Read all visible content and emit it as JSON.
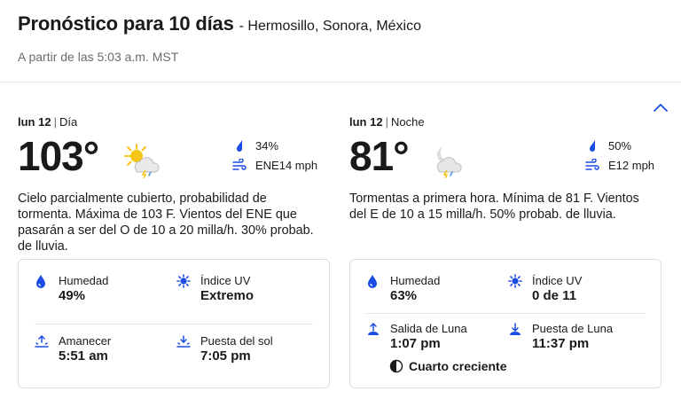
{
  "header": {
    "title": "Pronóstico para 10 días",
    "subtitle": "- Hermosillo, Sonora, México",
    "as_of": "A partir de las 5:03 a.m. MST"
  },
  "colors": {
    "accent": "#1b4de4",
    "text": "#1a1a1a",
    "muted": "#6b6b6b",
    "sun": "#f5c518"
  },
  "day": {
    "date": "lun 12",
    "period": "Día",
    "temp": "103°",
    "icon": "partly-cloudy-thunder-icon",
    "precip": "34%",
    "wind": "ENE14 mph",
    "narrative": "Cielo parcialmente cubierto, probabilidad de tormenta. Máxima de 103 F. Vientos del ENE que pasarán a ser del O de 10 a 20 milla/h. 30% probab. de lluvia.",
    "details": {
      "humidity_label": "Humedad",
      "humidity": "49%",
      "uv_label": "Índice UV",
      "uv": "Extremo",
      "sunrise_label": "Amanecer",
      "sunrise": "5:51 am",
      "sunset_label": "Puesta del sol",
      "sunset": "7:05 pm"
    }
  },
  "night": {
    "date": "lun 12",
    "period": "Noche",
    "temp": "81°",
    "icon": "night-cloud-thunder-icon",
    "precip": "50%",
    "wind": "E12 mph",
    "narrative": "Tormentas a primera hora. Mínima de 81 F. Vientos del E de 10 a 15 milla/h. 50% probab. de lluvia.",
    "details": {
      "humidity_label": "Humedad",
      "humidity": "63%",
      "uv_label": "Índice UV",
      "uv": "0 de 11",
      "moonrise_label": "Salida de Luna",
      "moonrise": "1:07 pm",
      "moonset_label": "Puesta de Luna",
      "moonset": "11:37 pm",
      "moon_phase": "Cuarto creciente"
    }
  }
}
